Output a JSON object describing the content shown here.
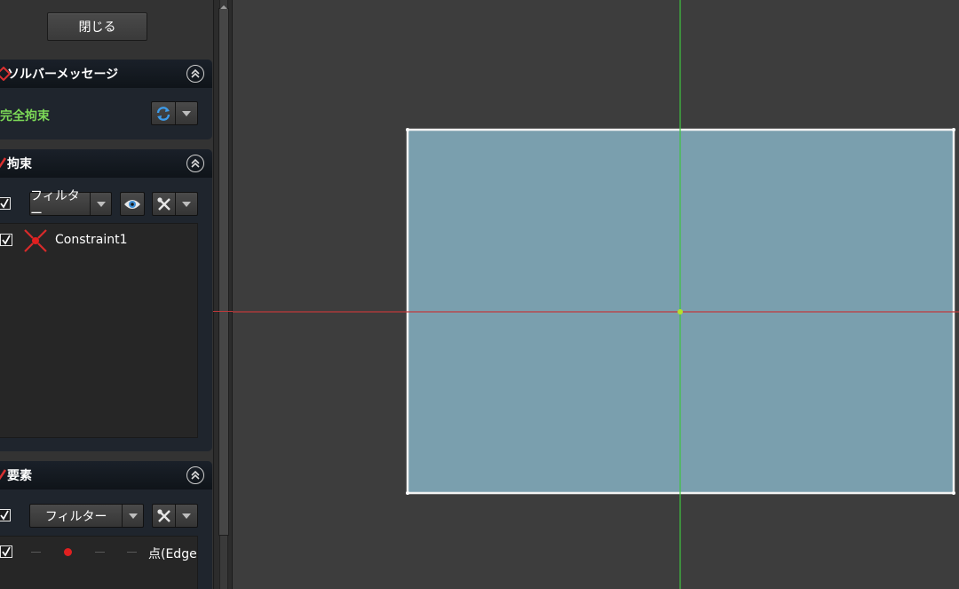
{
  "panel": {
    "close_label": "閉じる",
    "solver": {
      "title": "ソルバーメッセージ",
      "status": "完全拘束",
      "status_color": "#7cd957"
    },
    "constraints": {
      "title": "拘束",
      "filter_label": "フィルター",
      "items": [
        {
          "label": "Constraint1",
          "checked": true,
          "icon": "coincident-constraint-icon"
        }
      ]
    },
    "elements": {
      "title": "要素",
      "filter_label": "フィルター",
      "rows": [
        {
          "label": "点(Edge",
          "checked": true,
          "marker_color": "#e02020"
        }
      ]
    }
  },
  "viewport": {
    "background": "#3d3d3d",
    "rectangle_fill": "#7a9fae",
    "rectangle_edge": "#f2f2f2",
    "axis_h_color": "#c0393b",
    "axis_v_color": "#3fc43f",
    "origin_color": "#b7e02a"
  }
}
